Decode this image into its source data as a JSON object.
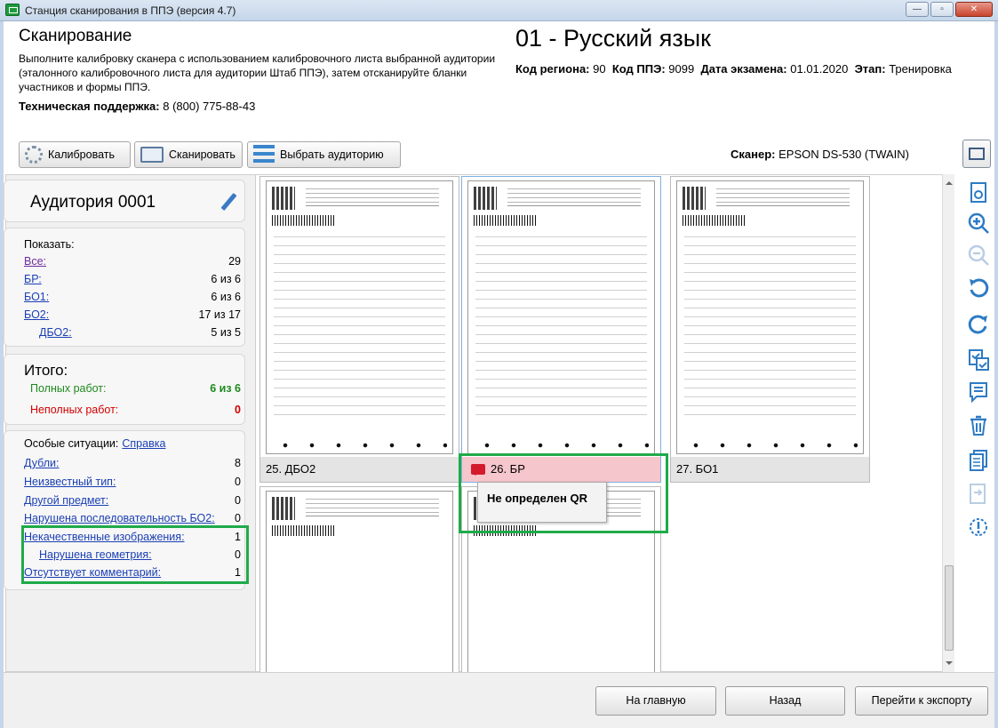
{
  "window": {
    "title": "Станция сканирования в ППЭ (версия 4.7)",
    "min": "—",
    "max": "▫",
    "close": "✕"
  },
  "header": {
    "title": "Сканирование",
    "description": "Выполните калибровку сканера с использованием калибровочного листа выбранной аудитории (эталонного калибровочного листа для аудитории Штаб ППЭ), затем отсканируйте бланки участников и формы ППЭ.",
    "support_label": "Техническая поддержка:",
    "support_phone": "8 (800) 775-88-43",
    "subject": "01 - Русский язык",
    "region_label": "Код региона:",
    "region": "90",
    "ppe_label": "Код ППЭ:",
    "ppe": "9099",
    "date_label": "Дата экзамена:",
    "date": "01.01.2020",
    "stage_label": "Этап:",
    "stage": "Тренировка"
  },
  "toolbar": {
    "calibrate": "Калибровать",
    "scan": "Сканировать",
    "choose_room": "Выбрать аудиторию",
    "scanner_label": "Сканер:",
    "scanner_name": "EPSON DS-530 (TWAIN)"
  },
  "left": {
    "room": "Аудитория 0001",
    "show_label": "Показать:",
    "filters": [
      {
        "label": "Все:",
        "value": "29"
      },
      {
        "label": "БР:",
        "value": "6 из 6"
      },
      {
        "label": "БО1:",
        "value": "6 из 6"
      },
      {
        "label": "БО2:",
        "value": "17 из 17"
      },
      {
        "label": "ДБО2:",
        "value": "5 из 5"
      }
    ],
    "total_label": "Итого:",
    "full_label": "Полных работ:",
    "full_value": "6 из 6",
    "incomplete_label": "Неполных работ:",
    "incomplete_value": "0",
    "special_label": "Особые ситуации:",
    "help_link": "Справка",
    "special": [
      {
        "label": "Дубли:",
        "value": "8"
      },
      {
        "label": "Неизвестный тип:",
        "value": "0"
      },
      {
        "label": "Другой предмет:",
        "value": "0"
      },
      {
        "label": "Нарушена последовательность БО2:",
        "value": "0"
      },
      {
        "label": "Некачественные изображения:",
        "value": "1"
      },
      {
        "label": "Нарушена геометрия:",
        "value": "0"
      },
      {
        "label": "Отсутствует комментарий:",
        "value": "1"
      }
    ]
  },
  "thumbs": [
    {
      "caption": "25. ДБО2"
    },
    {
      "caption": "26. БР"
    },
    {
      "caption": "27. БО1"
    }
  ],
  "tooltip": "Не определен QR",
  "bottom": {
    "home": "На главную",
    "back": "Назад",
    "export": "Перейти к экспорту"
  },
  "colors": {
    "highlight": "#1faa4a",
    "error_caption": "#f6c6cd",
    "accent_blue": "#3a86cc"
  }
}
